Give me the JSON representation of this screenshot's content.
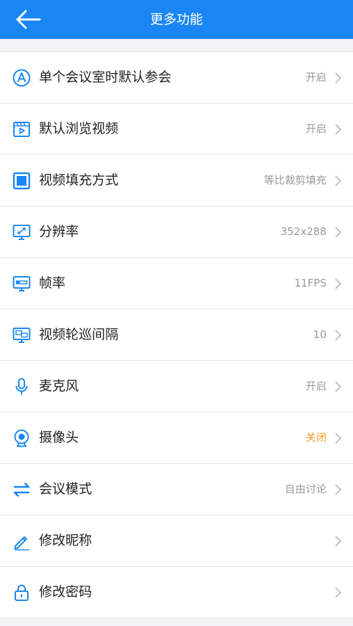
{
  "header": {
    "title": "更多功能",
    "back_icon": "arrow-left-icon"
  },
  "colors": {
    "primary": "#1a86f4",
    "warning": "#f39a1e"
  },
  "items": [
    {
      "label": "单个会议室时默认参会",
      "value": "开启",
      "icon": "letter-a-circle-icon"
    },
    {
      "label": "默认浏览视频",
      "value": "开启",
      "icon": "video-player-icon"
    },
    {
      "label": "视频填充方式",
      "value": "等比裁剪填充",
      "icon": "fill-square-icon"
    },
    {
      "label": "分辨率",
      "value": "352x288",
      "icon": "monitor-resize-icon"
    },
    {
      "label": "帧率",
      "value": "11FPS",
      "icon": "monitor-fps-icon"
    },
    {
      "label": "视频轮巡间隔",
      "value": "10",
      "icon": "monitor-grid-icon"
    },
    {
      "label": "麦克风",
      "value": "开启",
      "icon": "microphone-icon"
    },
    {
      "label": "摄像头",
      "value": "关闭",
      "icon": "webcam-icon"
    },
    {
      "label": "会议模式",
      "value": "自由讨论",
      "icon": "swap-arrows-icon"
    },
    {
      "label": "修改昵称",
      "value": "",
      "icon": "pencil-icon"
    },
    {
      "label": "修改密码",
      "value": "",
      "icon": "lock-icon"
    }
  ]
}
